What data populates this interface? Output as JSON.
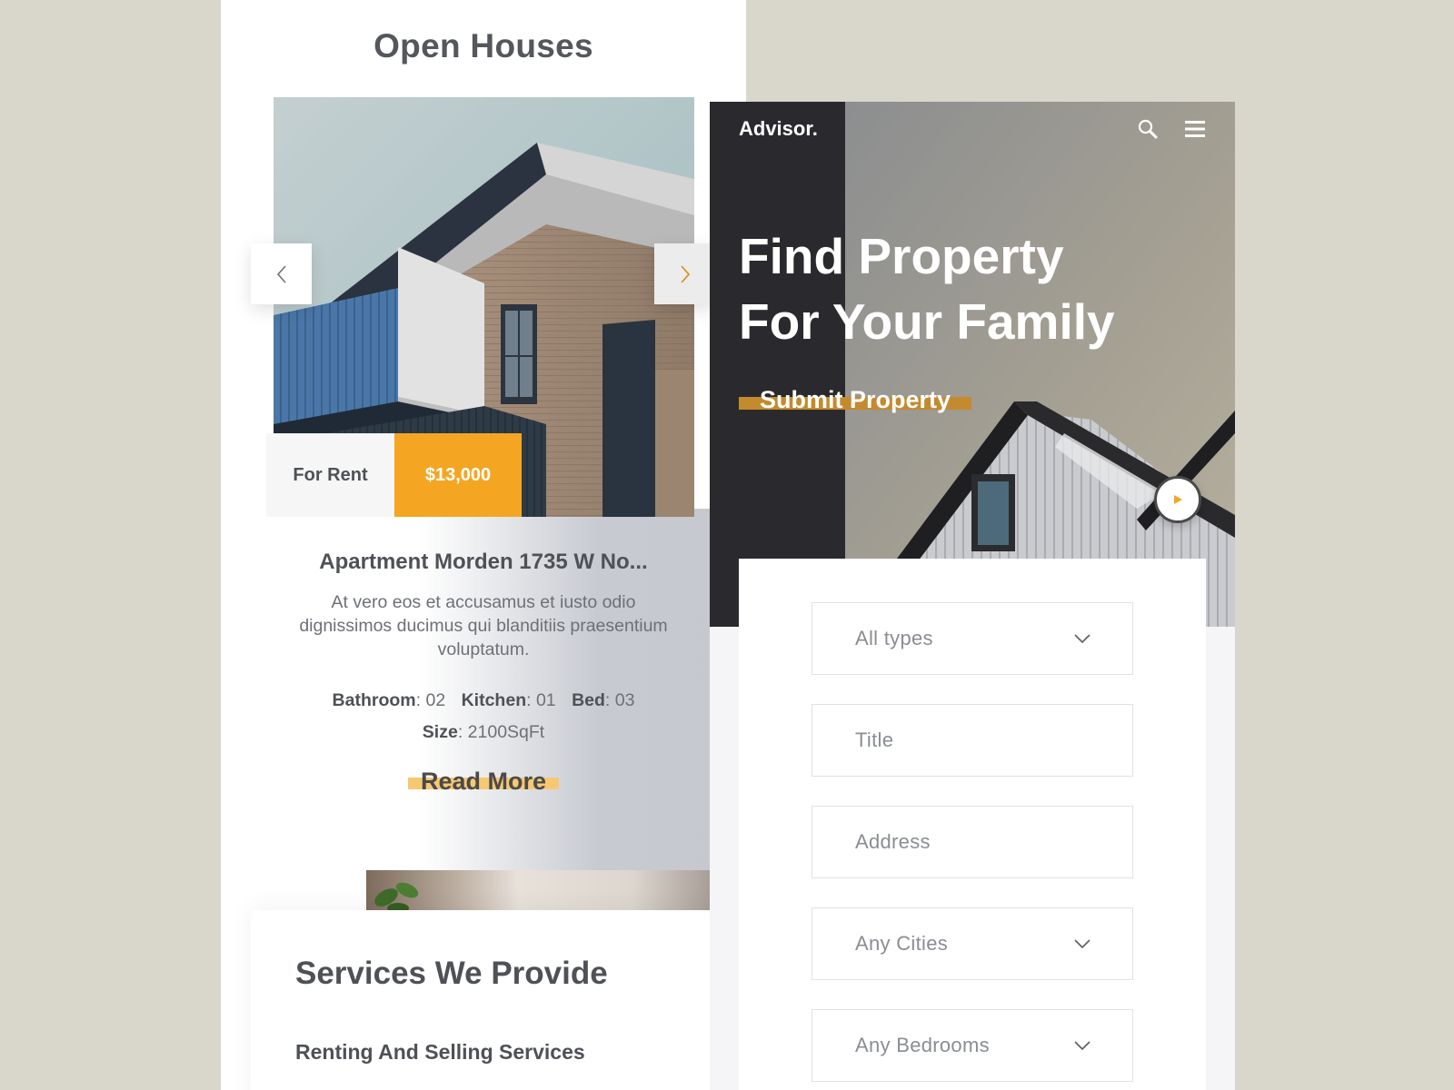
{
  "open_houses": {
    "title": "Open Houses",
    "tag_status": "For Rent",
    "tag_price": "$13,000",
    "listing_title": "Apartment Morden 1735 W No...",
    "description": "At vero eos et accusamus et iusto odio dignissimos ducimus qui blanditiis praesentium voluptatum.",
    "specs": [
      {
        "label": "Bathroom",
        "value": "02"
      },
      {
        "label": "Kitchen",
        "value": "01"
      },
      {
        "label": "Bed",
        "value": "03"
      },
      {
        "label": "Size",
        "value": "2100SqFt"
      }
    ],
    "read_more": "Read More"
  },
  "services": {
    "title": "Services We Provide",
    "subtitle": "Renting And Selling Services"
  },
  "advisor": {
    "brand": "Advisor.",
    "hero_line1": "Find Property",
    "hero_line2": "For Your Family",
    "submit_label": "Submit Property",
    "fields": [
      {
        "placeholder": "All types",
        "dropdown": true
      },
      {
        "placeholder": "Title",
        "dropdown": false
      },
      {
        "placeholder": "Address",
        "dropdown": false
      },
      {
        "placeholder": "Any Cities",
        "dropdown": true
      },
      {
        "placeholder": "Any Bedrooms",
        "dropdown": true
      }
    ]
  },
  "colors": {
    "background": "#d9d7cb",
    "accent_orange": "#f4a623",
    "accent_gold": "#c48a2e",
    "text_dark": "#4e5156",
    "hero_dark": "#2a2a2e"
  },
  "icons": [
    "chevron-left-icon",
    "chevron-right-icon",
    "search-icon",
    "menu-icon",
    "play-icon",
    "chevron-down-icon"
  ]
}
